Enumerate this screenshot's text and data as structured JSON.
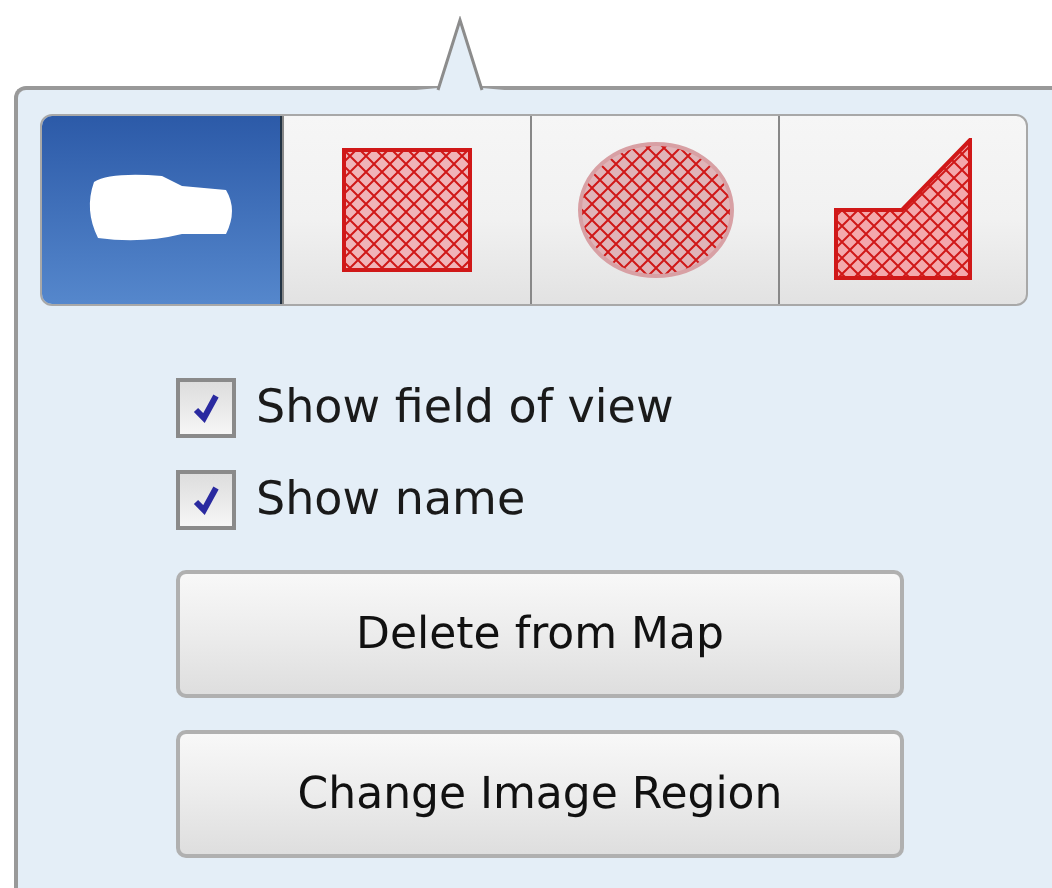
{
  "shape_tools": [
    {
      "kind": "camera",
      "selected": true
    },
    {
      "kind": "rectangle",
      "selected": false
    },
    {
      "kind": "ellipse",
      "selected": false
    },
    {
      "kind": "polygon",
      "selected": false
    }
  ],
  "options": [
    {
      "label": "Show field of view",
      "checked": true
    },
    {
      "label": "Show name",
      "checked": true
    }
  ],
  "buttons": [
    "Delete from Map",
    "Change Image Region"
  ]
}
